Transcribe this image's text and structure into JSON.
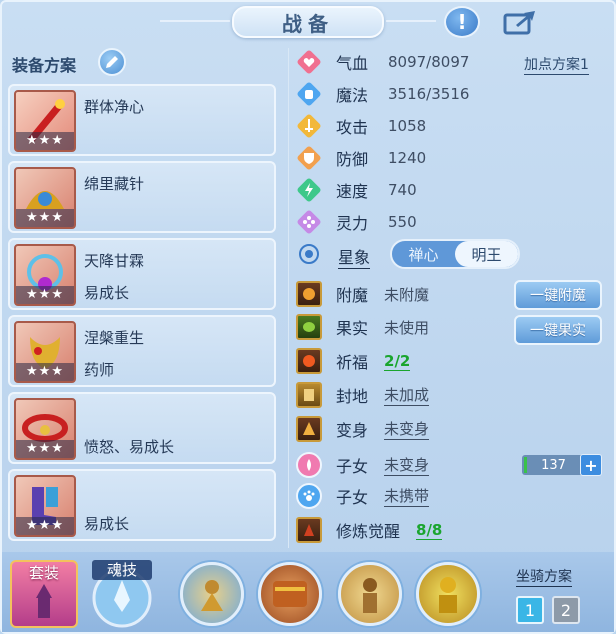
{
  "window": {
    "title": "战备"
  },
  "left": {
    "title": "装备方案",
    "plans": [
      {
        "name": "群体净心",
        "sub": "",
        "stars": "★★★"
      },
      {
        "name": "绵里藏针",
        "sub": "",
        "stars": "★★★"
      },
      {
        "name": "天降甘霖",
        "sub": "易成长",
        "stars": "★★★"
      },
      {
        "name": "涅槃重生",
        "sub": "药师",
        "stars": "★★★"
      },
      {
        "name": "",
        "sub": "愤怒、易成长",
        "stars": "★★★"
      },
      {
        "name": "",
        "sub": "易成长",
        "stars": "★★★"
      }
    ]
  },
  "stats": {
    "addpoint_label": "加点方案1",
    "rows": [
      {
        "label": "气血",
        "value": "8097/8097",
        "icon": "heart-icon",
        "color": "#f07090"
      },
      {
        "label": "魔法",
        "value": "3516/3516",
        "icon": "mana-icon",
        "color": "#4ea6f0"
      },
      {
        "label": "攻击",
        "value": "1058",
        "icon": "sword-icon",
        "color": "#f2b83a"
      },
      {
        "label": "防御",
        "value": "1240",
        "icon": "shield-icon",
        "color": "#f2a04e"
      },
      {
        "label": "速度",
        "value": "740",
        "icon": "lightning-icon",
        "color": "#3ec88a"
      },
      {
        "label": "灵力",
        "value": "550",
        "icon": "spirit-icon",
        "color": "#c58ae6"
      }
    ],
    "star_label": "星象",
    "toggle": {
      "left": "禅心",
      "right": "明王"
    }
  },
  "extras": {
    "enchant": {
      "label": "附魔",
      "value": "未附魔",
      "button": "一键附魔"
    },
    "fruit": {
      "label": "果实",
      "value": "未使用",
      "button": "一键果实"
    },
    "bless": {
      "label": "祈福",
      "value": "2/2"
    },
    "seal": {
      "label": "封地",
      "value": "未加成"
    },
    "transform": {
      "label": "变身",
      "value": "未变身"
    },
    "child1": {
      "label": "子女",
      "value": "未变身",
      "counter": "137",
      "plus": "+"
    },
    "child2": {
      "label": "子女",
      "value": "未携带"
    },
    "cultivate": {
      "label": "修炼觉醒",
      "value": "8/8"
    }
  },
  "bottom": {
    "suit_label": "套装",
    "soul_label": "魂技",
    "mount_title": "坐骑方案",
    "mount_options": [
      "1",
      "2"
    ]
  },
  "help_label": "!"
}
